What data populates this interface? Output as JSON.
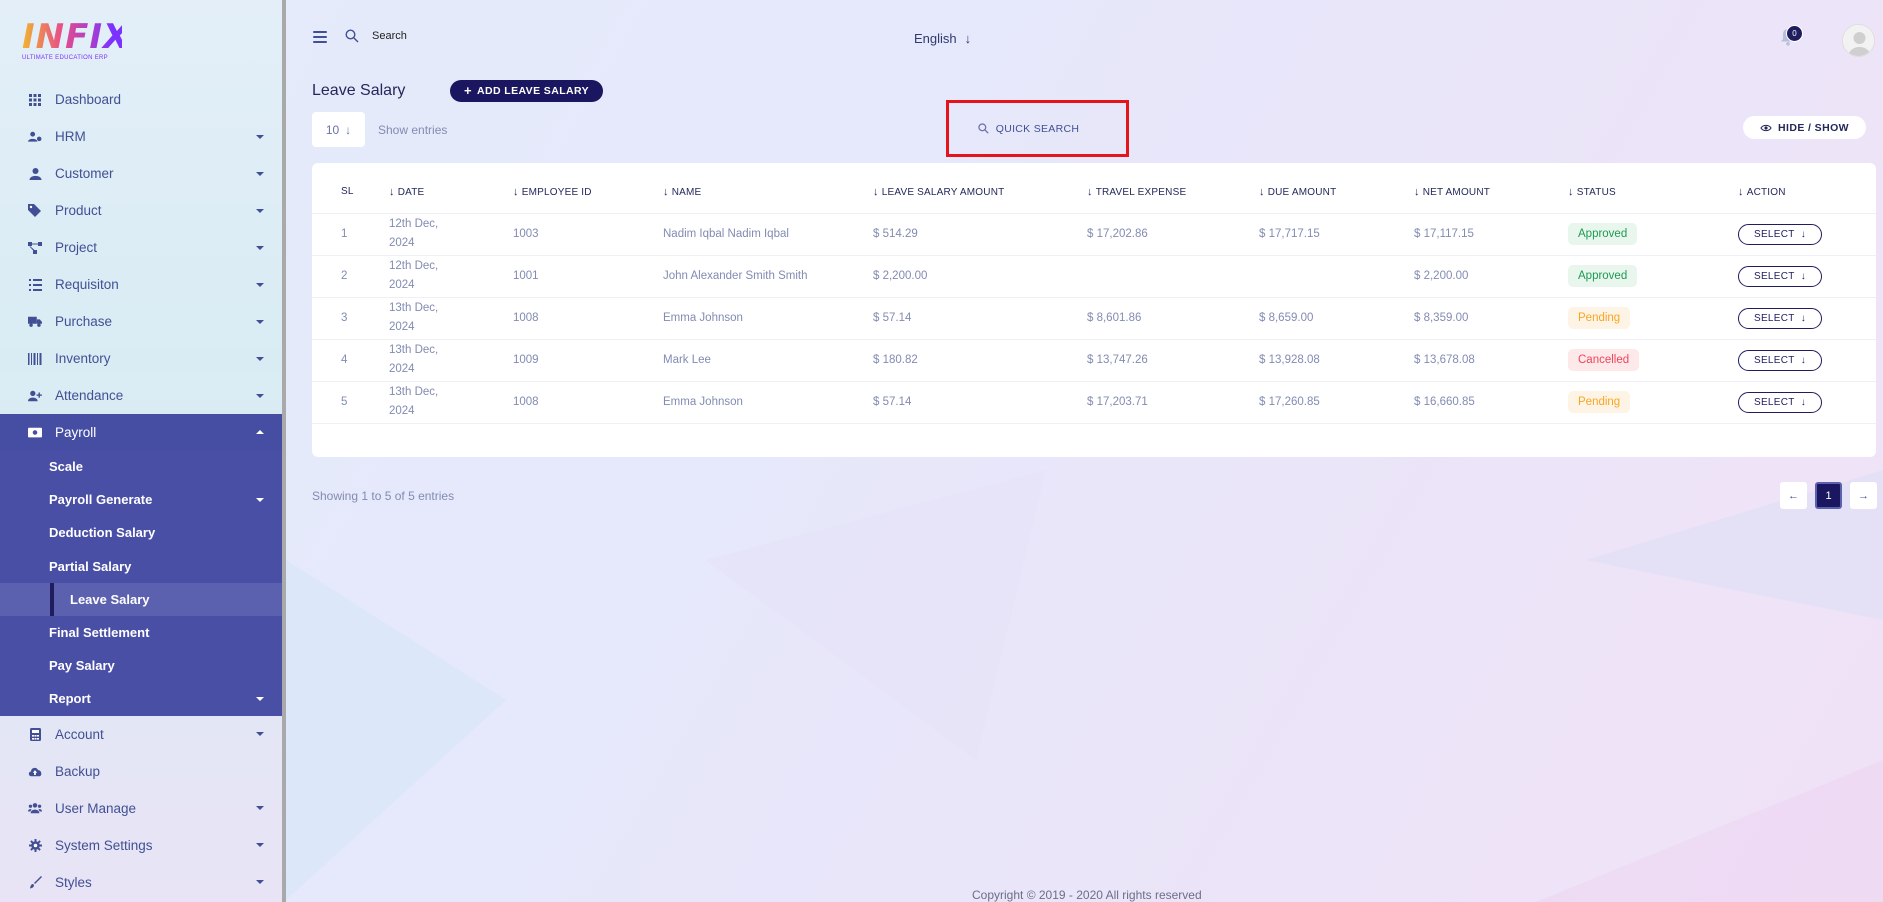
{
  "brand": {
    "logo_text": "INFIX",
    "tagline": "ULTIMATE EDUCATION ERP"
  },
  "sidebar": {
    "items": [
      {
        "label": "Dashboard",
        "icon": "grid-icon",
        "has_caret": false
      },
      {
        "label": "HRM",
        "icon": "users-cog-icon",
        "has_caret": true
      },
      {
        "label": "Customer",
        "icon": "user-icon",
        "has_caret": true
      },
      {
        "label": "Product",
        "icon": "tags-icon",
        "has_caret": true
      },
      {
        "label": "Project",
        "icon": "project-diagram-icon",
        "has_caret": true
      },
      {
        "label": "Requisiton",
        "icon": "list-icon",
        "has_caret": true
      },
      {
        "label": "Purchase",
        "icon": "truck-icon",
        "has_caret": true
      },
      {
        "label": "Inventory",
        "icon": "barcode-icon",
        "has_caret": true
      },
      {
        "label": "Attendance",
        "icon": "user-plus-icon",
        "has_caret": true
      },
      {
        "label": "Payroll",
        "icon": "money-bill-icon",
        "has_caret": true,
        "active": true
      }
    ],
    "payroll_submenu": [
      {
        "label": "Scale",
        "has_caret": false
      },
      {
        "label": "Payroll Generate",
        "has_caret": true
      },
      {
        "label": "Deduction Salary",
        "has_caret": false
      },
      {
        "label": "Partial Salary",
        "has_caret": false
      },
      {
        "label": "Leave Salary",
        "has_caret": false,
        "current": true
      },
      {
        "label": "Final Settlement",
        "has_caret": false
      },
      {
        "label": "Pay Salary",
        "has_caret": false
      },
      {
        "label": "Report",
        "has_caret": true
      }
    ],
    "items_after": [
      {
        "label": "Account",
        "icon": "calculator-icon",
        "has_caret": true
      },
      {
        "label": "Backup",
        "icon": "cloud-upload-icon",
        "has_caret": false
      },
      {
        "label": "User Manage",
        "icon": "users-icon",
        "has_caret": true
      },
      {
        "label": "System Settings",
        "icon": "gear-icon",
        "has_caret": true
      },
      {
        "label": "Styles",
        "icon": "brush-icon",
        "has_caret": true
      }
    ]
  },
  "topbar": {
    "search_placeholder": "Search",
    "language": "English",
    "notification_count": "0"
  },
  "page": {
    "title": "Leave Salary",
    "add_button": "ADD LEAVE SALARY",
    "entries_value": "10",
    "entries_label": "Show entries",
    "quick_search": "QUICK SEARCH",
    "hide_show": "HIDE / SHOW"
  },
  "table": {
    "columns": [
      "SL",
      "DATE",
      "EMPLOYEE ID",
      "NAME",
      "LEAVE SALARY AMOUNT",
      "TRAVEL EXPENSE",
      "DUE AMOUNT",
      "NET AMOUNT",
      "STATUS",
      "ACTION"
    ],
    "rows": [
      {
        "sl": "1",
        "date": "12th Dec, 2024",
        "employee_id": "1003",
        "name": "Nadim Iqbal Nadim Iqbal",
        "leave_salary": "$ 514.29",
        "travel_expense": "$ 17,202.86",
        "due_amount": "$ 17,717.15",
        "net_amount": "$ 17,117.15",
        "status": "Approved",
        "action": "SELECT"
      },
      {
        "sl": "2",
        "date": "12th Dec, 2024",
        "employee_id": "1001",
        "name": "John Alexander Smith Smith",
        "leave_salary": "$ 2,200.00",
        "travel_expense": "",
        "due_amount": "",
        "net_amount": "$ 2,200.00",
        "status": "Approved",
        "action": "SELECT"
      },
      {
        "sl": "3",
        "date": "13th Dec, 2024",
        "employee_id": "1008",
        "name": "Emma Johnson",
        "leave_salary": "$ 57.14",
        "travel_expense": "$ 8,601.86",
        "due_amount": "$ 8,659.00",
        "net_amount": "$ 8,359.00",
        "status": "Pending",
        "action": "SELECT"
      },
      {
        "sl": "4",
        "date": "13th Dec, 2024",
        "employee_id": "1009",
        "name": "Mark Lee",
        "leave_salary": "$ 180.82",
        "travel_expense": "$ 13,747.26",
        "due_amount": "$ 13,928.08",
        "net_amount": "$ 13,678.08",
        "status": "Cancelled",
        "action": "SELECT"
      },
      {
        "sl": "5",
        "date": "13th Dec, 2024",
        "employee_id": "1008",
        "name": "Emma Johnson",
        "leave_salary": "$ 57.14",
        "travel_expense": "$ 17,203.71",
        "due_amount": "$ 17,260.85",
        "net_amount": "$ 16,660.85",
        "status": "Pending",
        "action": "SELECT"
      }
    ]
  },
  "pagination": {
    "summary": "Showing 1 to 5 of 5 entries",
    "current_page": "1"
  },
  "footer": {
    "copyright": "Copyright © 2019 - 2020 All rights reserved"
  },
  "colors": {
    "primary": "#1a1760",
    "sidebar_active": "#454ea2",
    "highlight": "#e5141b",
    "approved": "#1f9a53",
    "pending": "#f7a623",
    "cancelled": "#f0445a"
  }
}
